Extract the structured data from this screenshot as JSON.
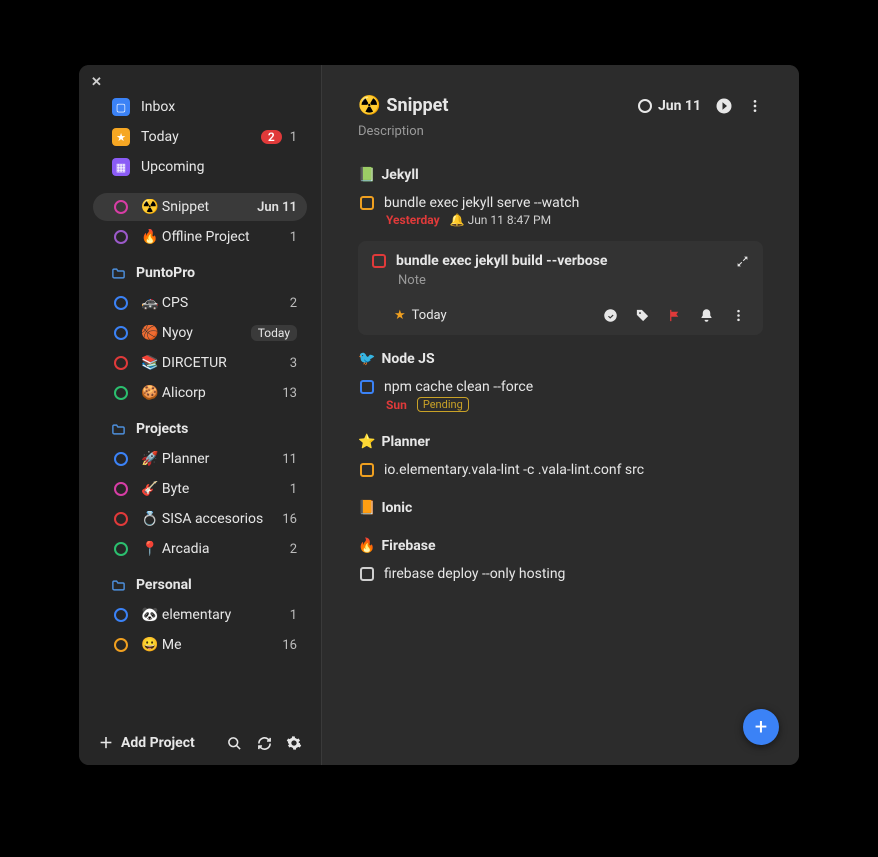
{
  "nav": [
    {
      "icon_box": "sq-blue",
      "glyph": "▢",
      "label": "Inbox",
      "badge": "",
      "pill": ""
    },
    {
      "icon_box": "sq-yellow",
      "glyph": "★",
      "label": "Today",
      "badge": "1",
      "pill": "2"
    },
    {
      "icon_box": "sq-purple",
      "glyph": "▦",
      "label": "Upcoming",
      "badge": "",
      "pill": ""
    }
  ],
  "sidebar_projects": [
    {
      "circle": "magenta",
      "emoji": "☢️",
      "label": "Snippet",
      "right_kind": "date",
      "right": "Jun 11",
      "selected": true
    },
    {
      "circle": "purple",
      "emoji": "🔥",
      "label": "Offline Project",
      "right_kind": "badge",
      "right": "1"
    }
  ],
  "groups": [
    {
      "name": "PuntoPro",
      "items": [
        {
          "circle": "blue",
          "emoji": "🚓",
          "label": "CPS",
          "right_kind": "badge",
          "right": "2"
        },
        {
          "circle": "blue",
          "emoji": "🏀",
          "label": "Nyoy",
          "right_kind": "today",
          "right": "Today"
        },
        {
          "circle": "red",
          "emoji": "📚",
          "label": "DIRCETUR",
          "right_kind": "badge",
          "right": "3"
        },
        {
          "circle": "green",
          "emoji": "🍪",
          "label": "Alicorp",
          "right_kind": "badge",
          "right": "13"
        }
      ]
    },
    {
      "name": "Projects",
      "items": [
        {
          "circle": "blue",
          "emoji": "🚀",
          "label": "Planner",
          "right_kind": "badge",
          "right": "11"
        },
        {
          "circle": "magenta",
          "emoji": "🎸",
          "label": "Byte",
          "right_kind": "badge",
          "right": "1"
        },
        {
          "circle": "red",
          "emoji": "💍",
          "label": "SISA accesorios",
          "right_kind": "badge",
          "right": "16"
        },
        {
          "circle": "green",
          "emoji": "📍",
          "label": "Arcadia",
          "right_kind": "badge",
          "right": "2"
        }
      ]
    },
    {
      "name": "Personal",
      "items": [
        {
          "circle": "blue",
          "emoji": "🐼",
          "label": "elementary",
          "right_kind": "badge",
          "right": "1"
        },
        {
          "circle": "orange",
          "emoji": "😀",
          "label": "Me",
          "right_kind": "badge",
          "right": "16"
        }
      ]
    }
  ],
  "sidebar_footer": {
    "add_project": "Add Project"
  },
  "header": {
    "icon": "☢️",
    "title": "Snippet",
    "date": "Jun 11",
    "description": "Description"
  },
  "sections": [
    {
      "icon": "📗",
      "title": "Jekyll",
      "tasks": [
        {
          "chk": "orange",
          "text": "bundle exec jekyll serve --watch",
          "sub": [
            {
              "type": "yesterday",
              "text": "Yesterday"
            },
            {
              "type": "bell",
              "text": "Jun 11 8:47 PM"
            }
          ]
        }
      ],
      "card": {
        "chk": "red",
        "title": "bundle exec jekyll build --verbose",
        "note": "Note",
        "today": "Today"
      }
    },
    {
      "icon": "🐦",
      "title": "Node JS",
      "tasks": [
        {
          "chk": "blue",
          "text": "npm cache clean --force",
          "sub": [
            {
              "type": "sun",
              "text": "Sun"
            },
            {
              "type": "pending",
              "text": "Pending"
            }
          ]
        }
      ]
    },
    {
      "icon": "⭐",
      "title": "Planner",
      "tasks": [
        {
          "chk": "orange",
          "text": "io.elementary.vala-lint -c .vala-lint.conf src",
          "sub": []
        }
      ]
    },
    {
      "icon": "📙",
      "title": "Ionic",
      "tasks": []
    },
    {
      "icon": "🔥",
      "title": "Firebase",
      "tasks": [
        {
          "chk": "grey",
          "text": "firebase deploy --only hosting",
          "sub": []
        }
      ]
    }
  ]
}
